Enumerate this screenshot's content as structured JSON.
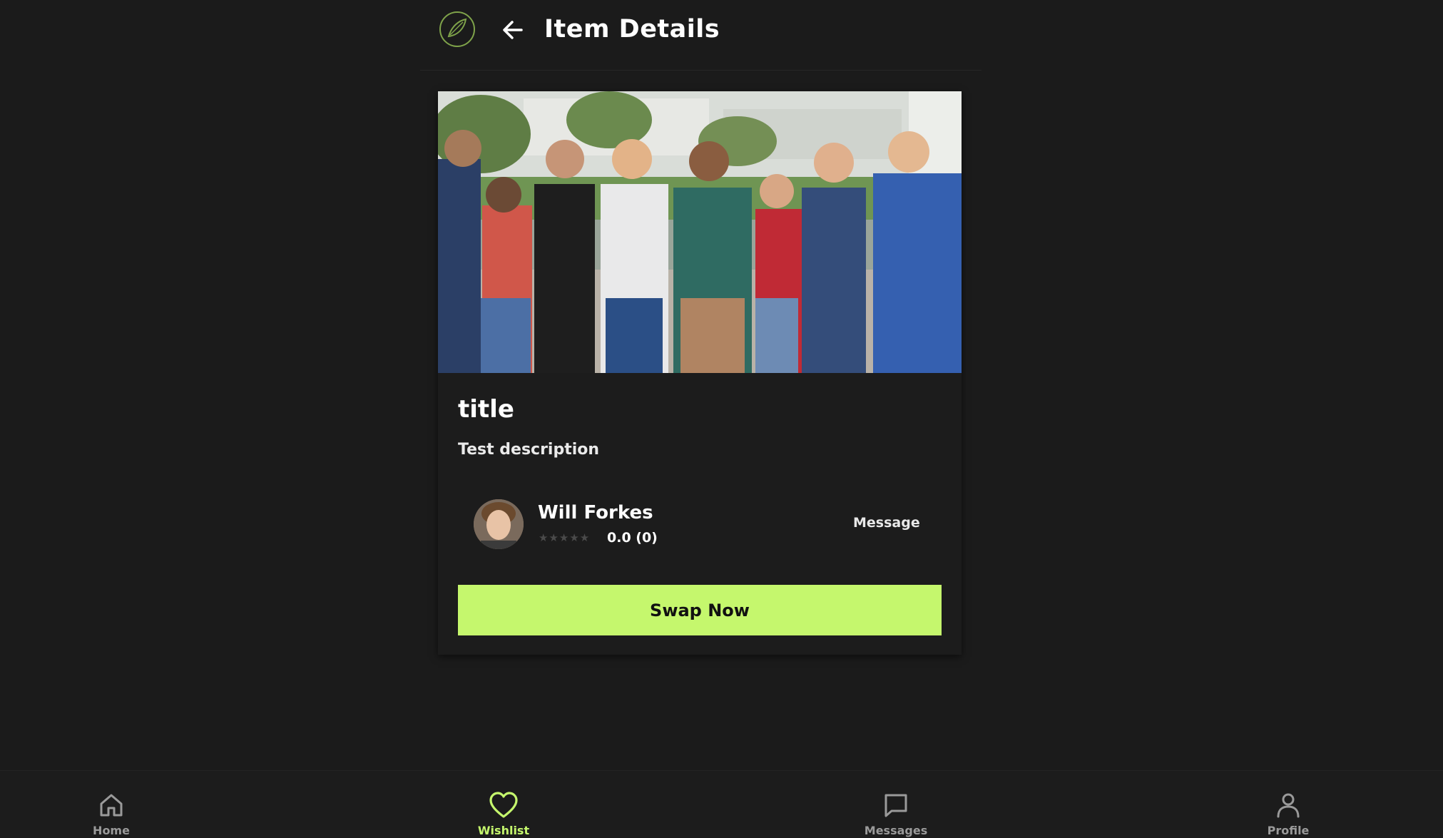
{
  "header": {
    "title": "Item Details",
    "logo_icon": "leaf-logo-icon",
    "back_icon": "arrow-left-icon"
  },
  "item": {
    "title": "title",
    "description": "Test description",
    "image_icon": "group-photo"
  },
  "seller": {
    "name": "Will Forkes",
    "stars": "★★★★★",
    "rating_text": "0.0 (0)",
    "rating_value": 0,
    "rating_count": 0,
    "message_label": "Message"
  },
  "actions": {
    "swap_label": "Swap Now"
  },
  "nav": {
    "items": [
      {
        "label": "Home",
        "icon": "home-icon",
        "active": false
      },
      {
        "label": "Wishlist",
        "icon": "heart-icon",
        "active": true
      },
      {
        "label": "Messages",
        "icon": "chat-bubble-icon",
        "active": false
      },
      {
        "label": "Profile",
        "icon": "person-icon",
        "active": false
      }
    ]
  },
  "colors": {
    "background": "#1b1b1b",
    "accent": "#c5f76d",
    "text": "#ffffff",
    "muted": "#9a9a9a"
  }
}
